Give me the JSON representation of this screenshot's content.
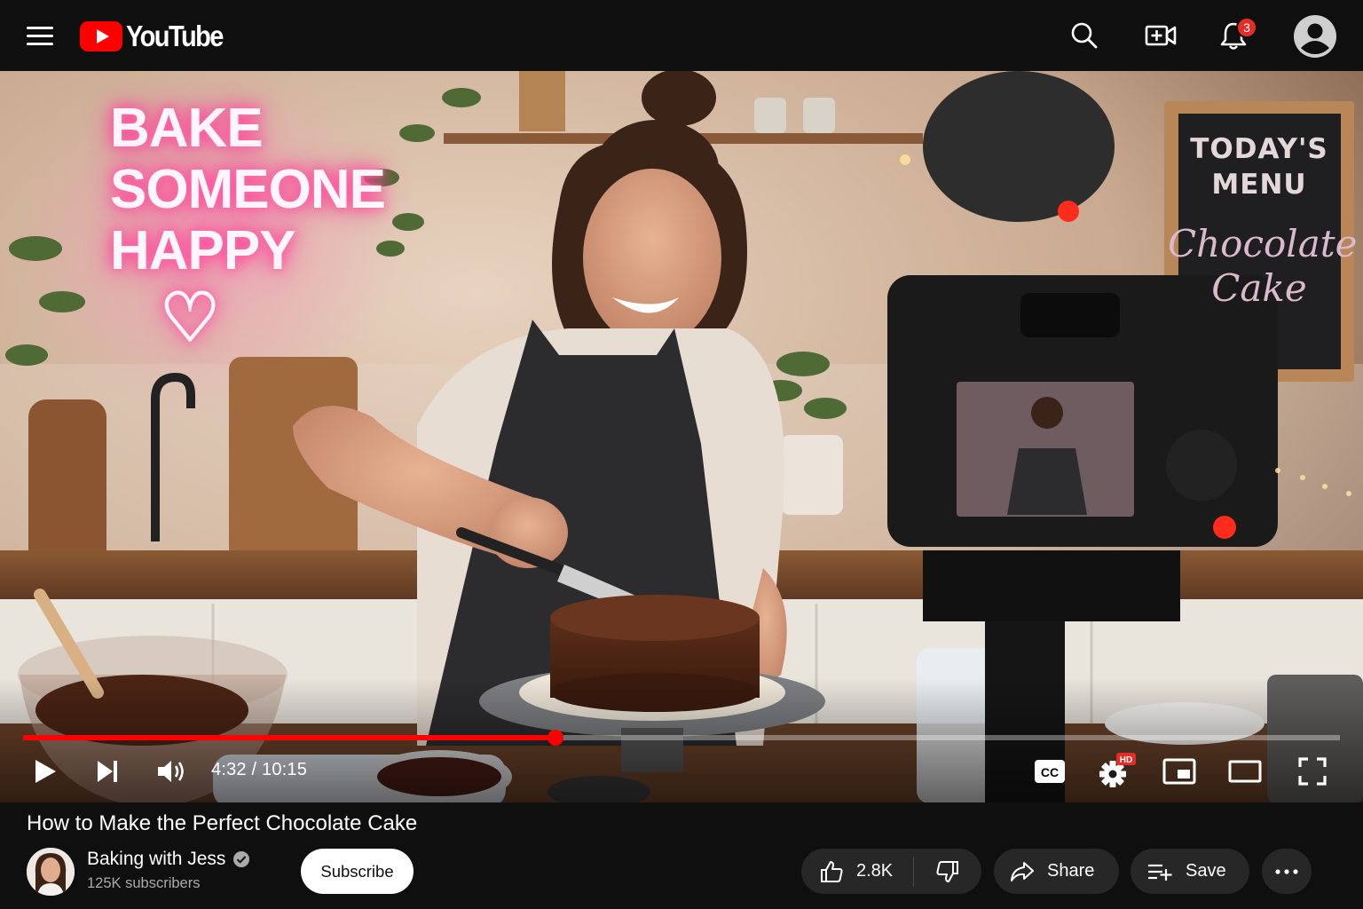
{
  "header": {
    "logo_text": "YouTube",
    "brand_color": "#ff0000",
    "notifications_count": "3",
    "icons": [
      "menu-icon",
      "search-icon",
      "create-video-icon",
      "bell-icon",
      "account-icon"
    ]
  },
  "player": {
    "scene_text": {
      "neon_sign": [
        "BAKE",
        "SOMEONE",
        "HAPPY"
      ],
      "neon_heart": "♡",
      "chalkboard_title": [
        "TODAY'S",
        "MENU"
      ],
      "chalkboard_item": [
        "Chocolate",
        "Cake"
      ]
    },
    "time_display": "4:32 / 10:15",
    "progress_fraction": 0.404,
    "quality_badge": "HD",
    "captions_label": "CC",
    "controls": [
      "play-icon",
      "next-icon",
      "volume-icon",
      "captions-icon",
      "settings-icon",
      "miniplayer-icon",
      "theater-icon",
      "fullscreen-icon"
    ]
  },
  "video": {
    "title": "How to Make the Perfect Chocolate Cake",
    "channel_name": "Baking with Jess",
    "subscribers": "125K subscribers",
    "subscribe_label": "Subscribe",
    "likes": "2.8K",
    "share_label": "Share",
    "save_label": "Save"
  }
}
